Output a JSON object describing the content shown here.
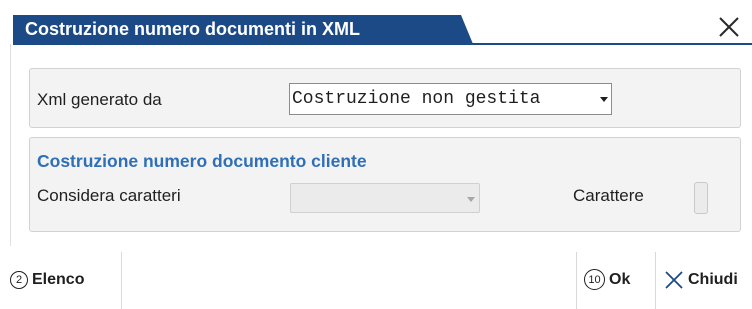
{
  "window": {
    "title": "Costruzione numero documenti in XML",
    "close_icon": "close-icon",
    "accent_color": "#1b4a86"
  },
  "group_xml": {
    "label": "Xml generato da",
    "select_value": "Costruzione non gestita"
  },
  "group_cliente": {
    "title": "Costruzione numero documento cliente",
    "considera_label": "Considera caratteri",
    "considera_value": "",
    "carattere_label": "Carattere",
    "carattere_value": ""
  },
  "footer": {
    "elenco": {
      "key": "2",
      "label": "Elenco"
    },
    "ok": {
      "key": "10",
      "label": "Ok"
    },
    "chiudi": {
      "label": "Chiudi",
      "icon": "close-icon"
    }
  }
}
